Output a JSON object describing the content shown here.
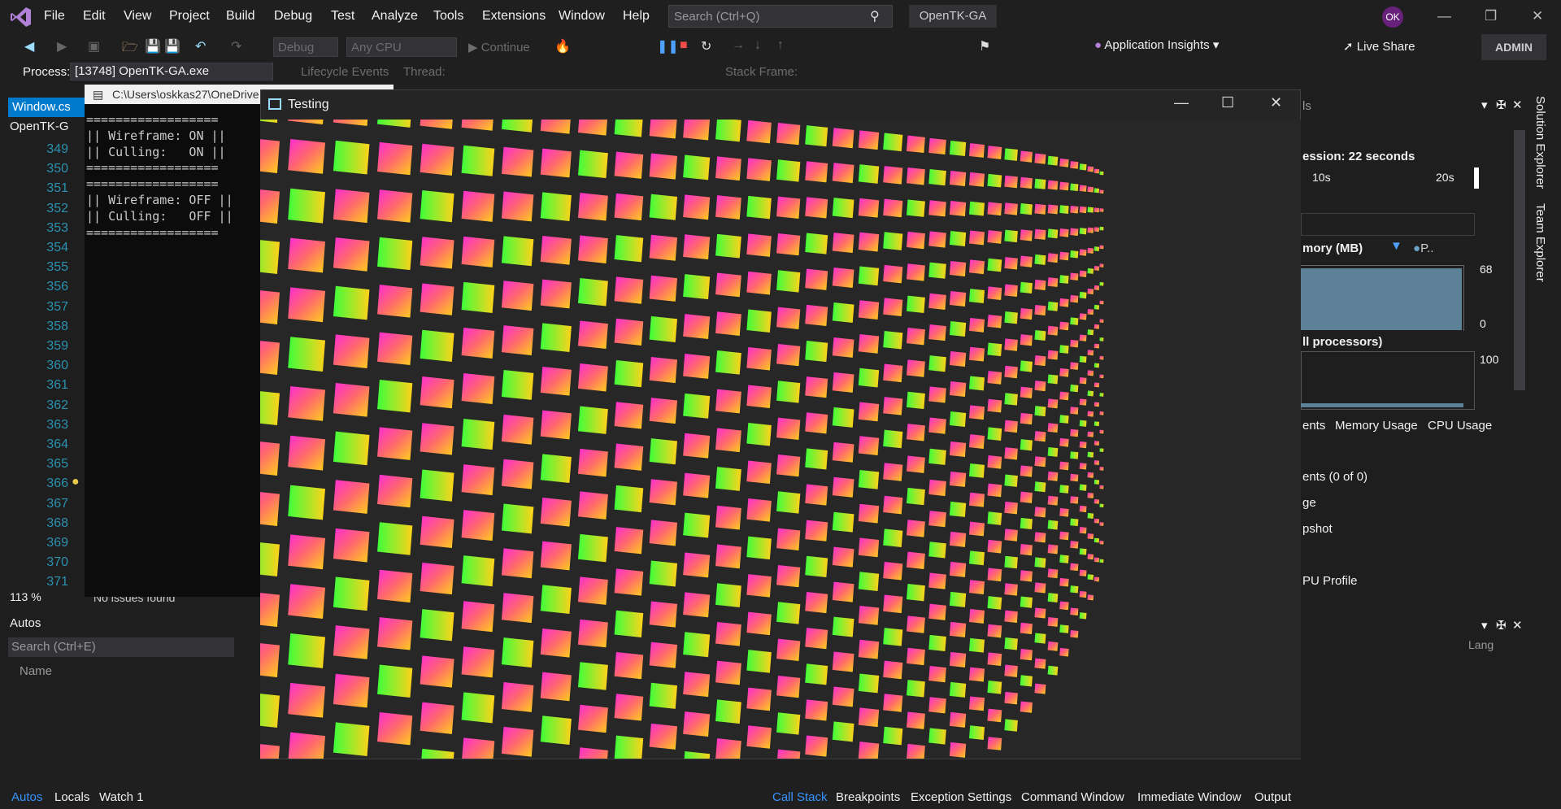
{
  "menu": [
    "File",
    "Edit",
    "View",
    "Project",
    "Build",
    "Debug",
    "Test",
    "Analyze",
    "Tools",
    "Extensions",
    "Window",
    "Help"
  ],
  "search": {
    "placeholder": "Search (Ctrl+Q)"
  },
  "solution_name": "OpenTK-GA",
  "user_initials": "OK",
  "toolbar": {
    "config": "Debug",
    "platform": "Any CPU",
    "continue_label": "Continue",
    "app_insights": "Application Insights",
    "live_share": "Live Share",
    "admin": "ADMIN"
  },
  "debug_location": {
    "process_label": "Process:",
    "process_value": "[13748] OpenTK-GA.exe",
    "lifecycle": "Lifecycle Events",
    "thread_label": "Thread:",
    "stack_frame_label": "Stack Frame:"
  },
  "editor": {
    "tab": "Window.cs",
    "nav": "OpenTK-G",
    "line_numbers": [
      "349",
      "350",
      "351",
      "352",
      "353",
      "354",
      "355",
      "356",
      "357",
      "358",
      "359",
      "360",
      "361",
      "362",
      "363",
      "364",
      "365",
      "366",
      "367",
      "368",
      "369",
      "370",
      "371"
    ],
    "zoom": "113 %",
    "issues": "No issues found"
  },
  "console": {
    "path": "C:\\Users\\oskkas27\\OneDrive",
    "lines": [
      "==================",
      "|| Wireframe: ON ||",
      "|| Culling:   ON ||",
      "==================",
      "==================",
      "|| Wireframe: OFF ||",
      "|| Culling:   OFF ||",
      "=================="
    ]
  },
  "autos": {
    "title": "Autos",
    "search_placeholder": "Search (Ctrl+E)",
    "col_name": "Name",
    "col_lang": "Lang",
    "tabs": [
      "Autos",
      "Locals",
      "Watch 1"
    ]
  },
  "bottom_right_tabs": [
    "Call Stack",
    "Breakpoints",
    "Exception Settings",
    "Command Window",
    "Immediate Window",
    "Output"
  ],
  "diagnostics": {
    "title_fragment": "ls",
    "session": "ession: 22 seconds",
    "tick_10": "10s",
    "tick_20": "20s",
    "memory": "mory (MB)",
    "memory_legend": "P..",
    "mem_max": "68",
    "mem_min": "0",
    "cpu": "ll processors)",
    "cpu_max": "100",
    "tabs": [
      "ents",
      "Memory Usage",
      "CPU Usage"
    ],
    "rows": [
      "ents (0 of 0)",
      "ge",
      "pshot",
      "PU Profile"
    ]
  },
  "side_tabs": [
    "Solution Explorer",
    "Team Explorer"
  ],
  "test_window": {
    "title": "Testing"
  },
  "colors": {
    "accent": "#007acc",
    "console_bg": "#0c0c0c",
    "cube_a": "#ff2bd6",
    "cube_b": "#ffd21a",
    "cube_c": "#3dff3a"
  }
}
